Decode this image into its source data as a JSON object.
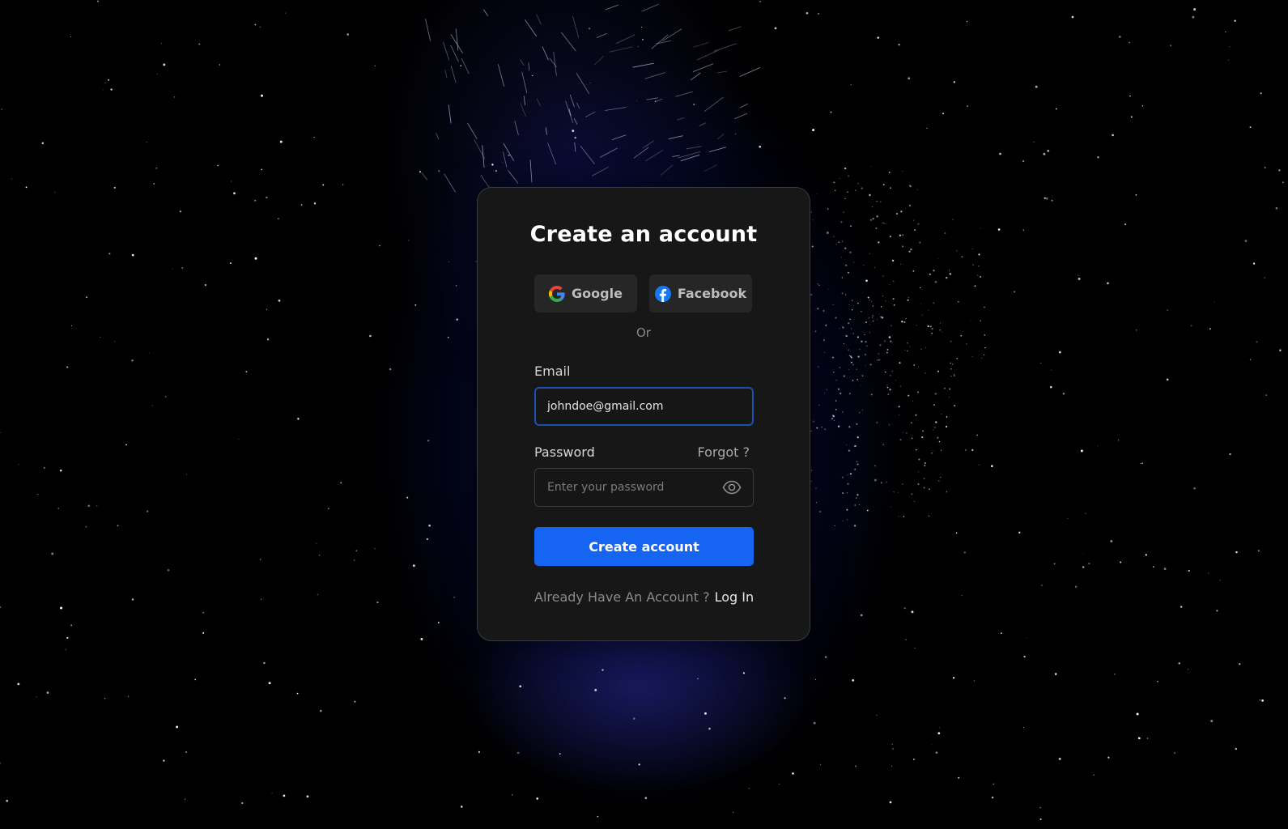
{
  "form": {
    "title": "Create an account",
    "social": {
      "google_label": "Google",
      "facebook_label": "Facebook"
    },
    "divider_text": "Or",
    "email": {
      "label": "Email",
      "value": "johndoe@gmail.com",
      "placeholder": ""
    },
    "password": {
      "label": "Password",
      "forgot_label": "Forgot ?",
      "value": "",
      "placeholder": "Enter your password",
      "toggle_icon": "eye-icon"
    },
    "submit_label": "Create account",
    "footer": {
      "question": "Already Have An Account ?",
      "login_label": "Log In"
    }
  },
  "colors": {
    "card_background": "#171717",
    "primary_button": "#1565f2",
    "email_focus_border": "#1b4fb0",
    "social_button_background": "#262626",
    "page_background": "#000000"
  },
  "icons": {
    "google": "google-logo-icon",
    "facebook": "facebook-logo-icon",
    "password_toggle": "eye-icon"
  }
}
